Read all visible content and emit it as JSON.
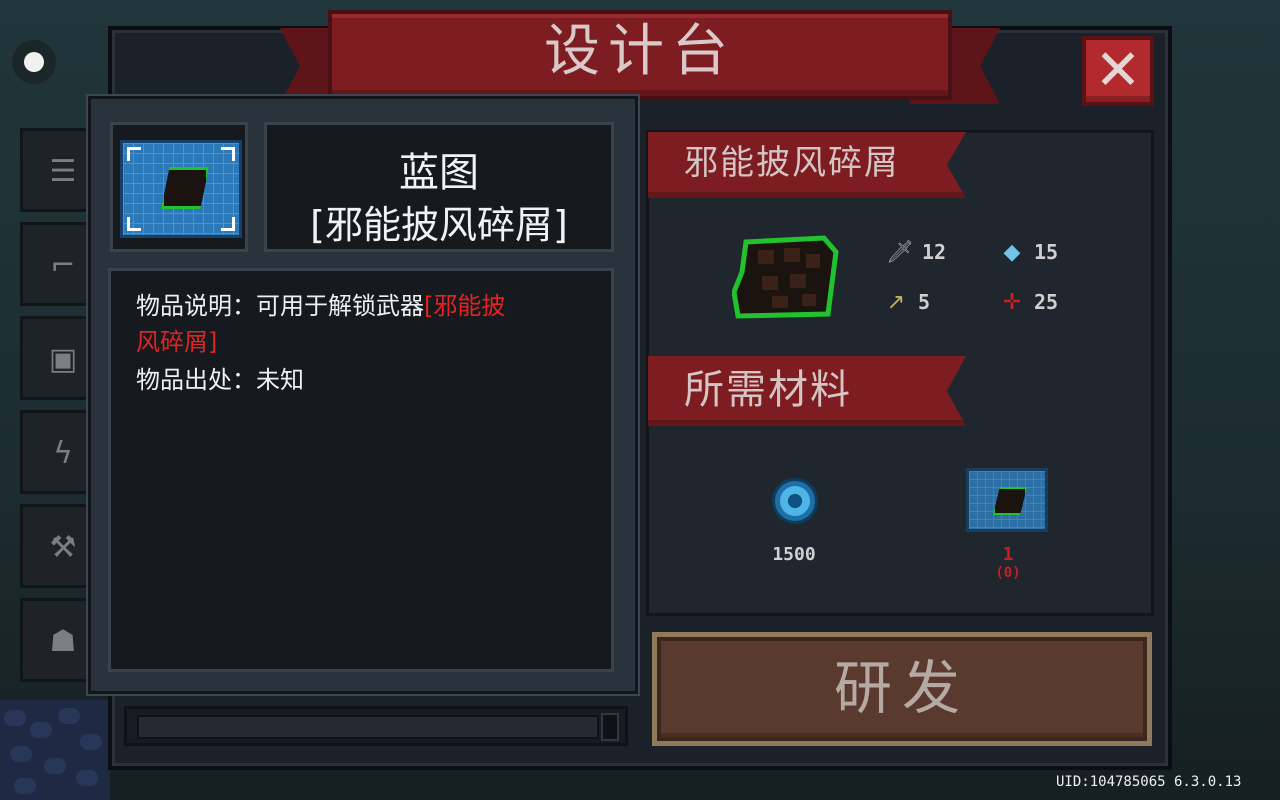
{
  "title": "设计台",
  "close_icon": "close-icon",
  "side_tabs": [
    {
      "icon": "list-icon",
      "glyph": "☰"
    },
    {
      "icon": "gun-icon",
      "glyph": "⌐"
    },
    {
      "icon": "armor-icon",
      "glyph": "▣"
    },
    {
      "icon": "lightning-icon",
      "glyph": "ϟ"
    },
    {
      "icon": "workbench-icon",
      "glyph": "⚒"
    },
    {
      "icon": "robot-icon",
      "glyph": "☗"
    }
  ],
  "item_name_ribbon": "邪能披风碎屑",
  "stats": {
    "damage": "12",
    "energy": "15",
    "crit": "5",
    "spread": "25"
  },
  "materials_ribbon": "所需材料",
  "materials": [
    {
      "icon": "gem-icon",
      "count": "1500"
    },
    {
      "icon": "blueprint-icon",
      "count": "1",
      "owned": "(0)"
    }
  ],
  "research_label": "研发",
  "popup": {
    "title_line1": "蓝图",
    "title_line2": "[邪能披风碎屑]",
    "desc_label": "物品说明：可用于解锁武器",
    "desc_item_part1": "[邪能披",
    "desc_item_part2": "风碎屑]",
    "source_label": "物品出处：未知"
  },
  "uid": "UID:104785065 6.3.0.13",
  "colors": {
    "ribbon": "#7d1d22",
    "close": "#b22a2e",
    "highlight_red": "#e02424",
    "blueprint": "#2b79b8",
    "outline_green": "#21c22d"
  }
}
